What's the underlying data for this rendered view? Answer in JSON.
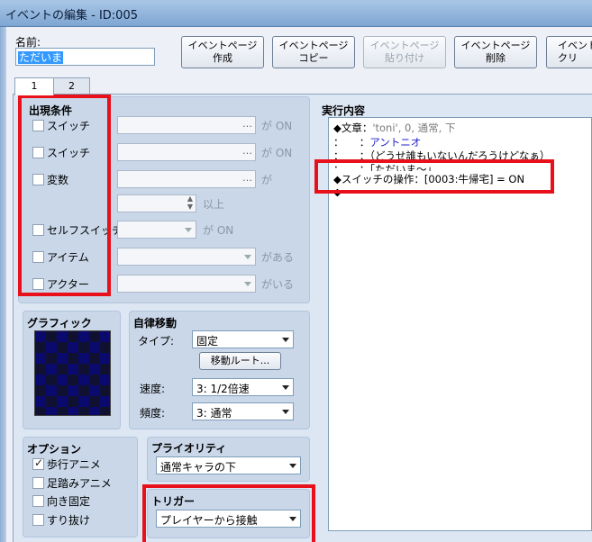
{
  "window": {
    "title": "イベントの編集 - ID:005"
  },
  "name": {
    "label": "名前:",
    "value": "ただいま"
  },
  "toolbar": {
    "create": "イベントページ\n作成",
    "copy": "イベントページ\nコピー",
    "paste": "イベントページ\n貼り付け",
    "delete": "イベントページ\n削除",
    "clear": "イベント\nクリ"
  },
  "tabs": [
    "1",
    "2"
  ],
  "conditions": {
    "title": "出現条件",
    "switch1": {
      "label": "スイッチ",
      "suffix": "が ON"
    },
    "switch2": {
      "label": "スイッチ",
      "suffix": "が ON"
    },
    "variable": {
      "label": "変数",
      "suffix": "が",
      "suffix2": "以上"
    },
    "self_switch": {
      "label": "セルフスイッチ",
      "suffix": "が ON"
    },
    "item": {
      "label": "アイテム",
      "suffix": "がある"
    },
    "actor": {
      "label": "アクター",
      "suffix": "がいる"
    }
  },
  "graphic": {
    "title": "グラフィック"
  },
  "autonomous": {
    "title": "自律移動",
    "type_label": "タイプ:",
    "type_value": "固定",
    "route_button": "移動ルート...",
    "speed_label": "速度:",
    "speed_value": "3: 1/2倍速",
    "freq_label": "頻度:",
    "freq_value": "3: 通常"
  },
  "options": {
    "title": "オプション",
    "walk": "歩行アニメ",
    "step": "足踏みアニメ",
    "dir_fix": "向き固定",
    "through": "すり抜け"
  },
  "priority": {
    "title": "プライオリティ",
    "value": "通常キャラの下"
  },
  "trigger": {
    "title": "トリガー",
    "value": "プレイヤーから接触"
  },
  "contents": {
    "title": "実行内容",
    "l1_a": "◆文章：",
    "l1_b": "'toni', 0, 通常, 下",
    "l2_a": "：　　：",
    "l2_b": "アントニオ",
    "l3_a": "：　　：",
    "l3_b": "（どうせ誰もいないんだろうけどなぁ）",
    "l4_a": "：　　：",
    "l4_b": "「ただいま～」",
    "l5": "◆スイッチの操作：[0003:牛帰宅] = ON",
    "l6": "◆"
  },
  "colors": {
    "highlight_red": "#e8101a",
    "text_blue": "#2222cc"
  }
}
